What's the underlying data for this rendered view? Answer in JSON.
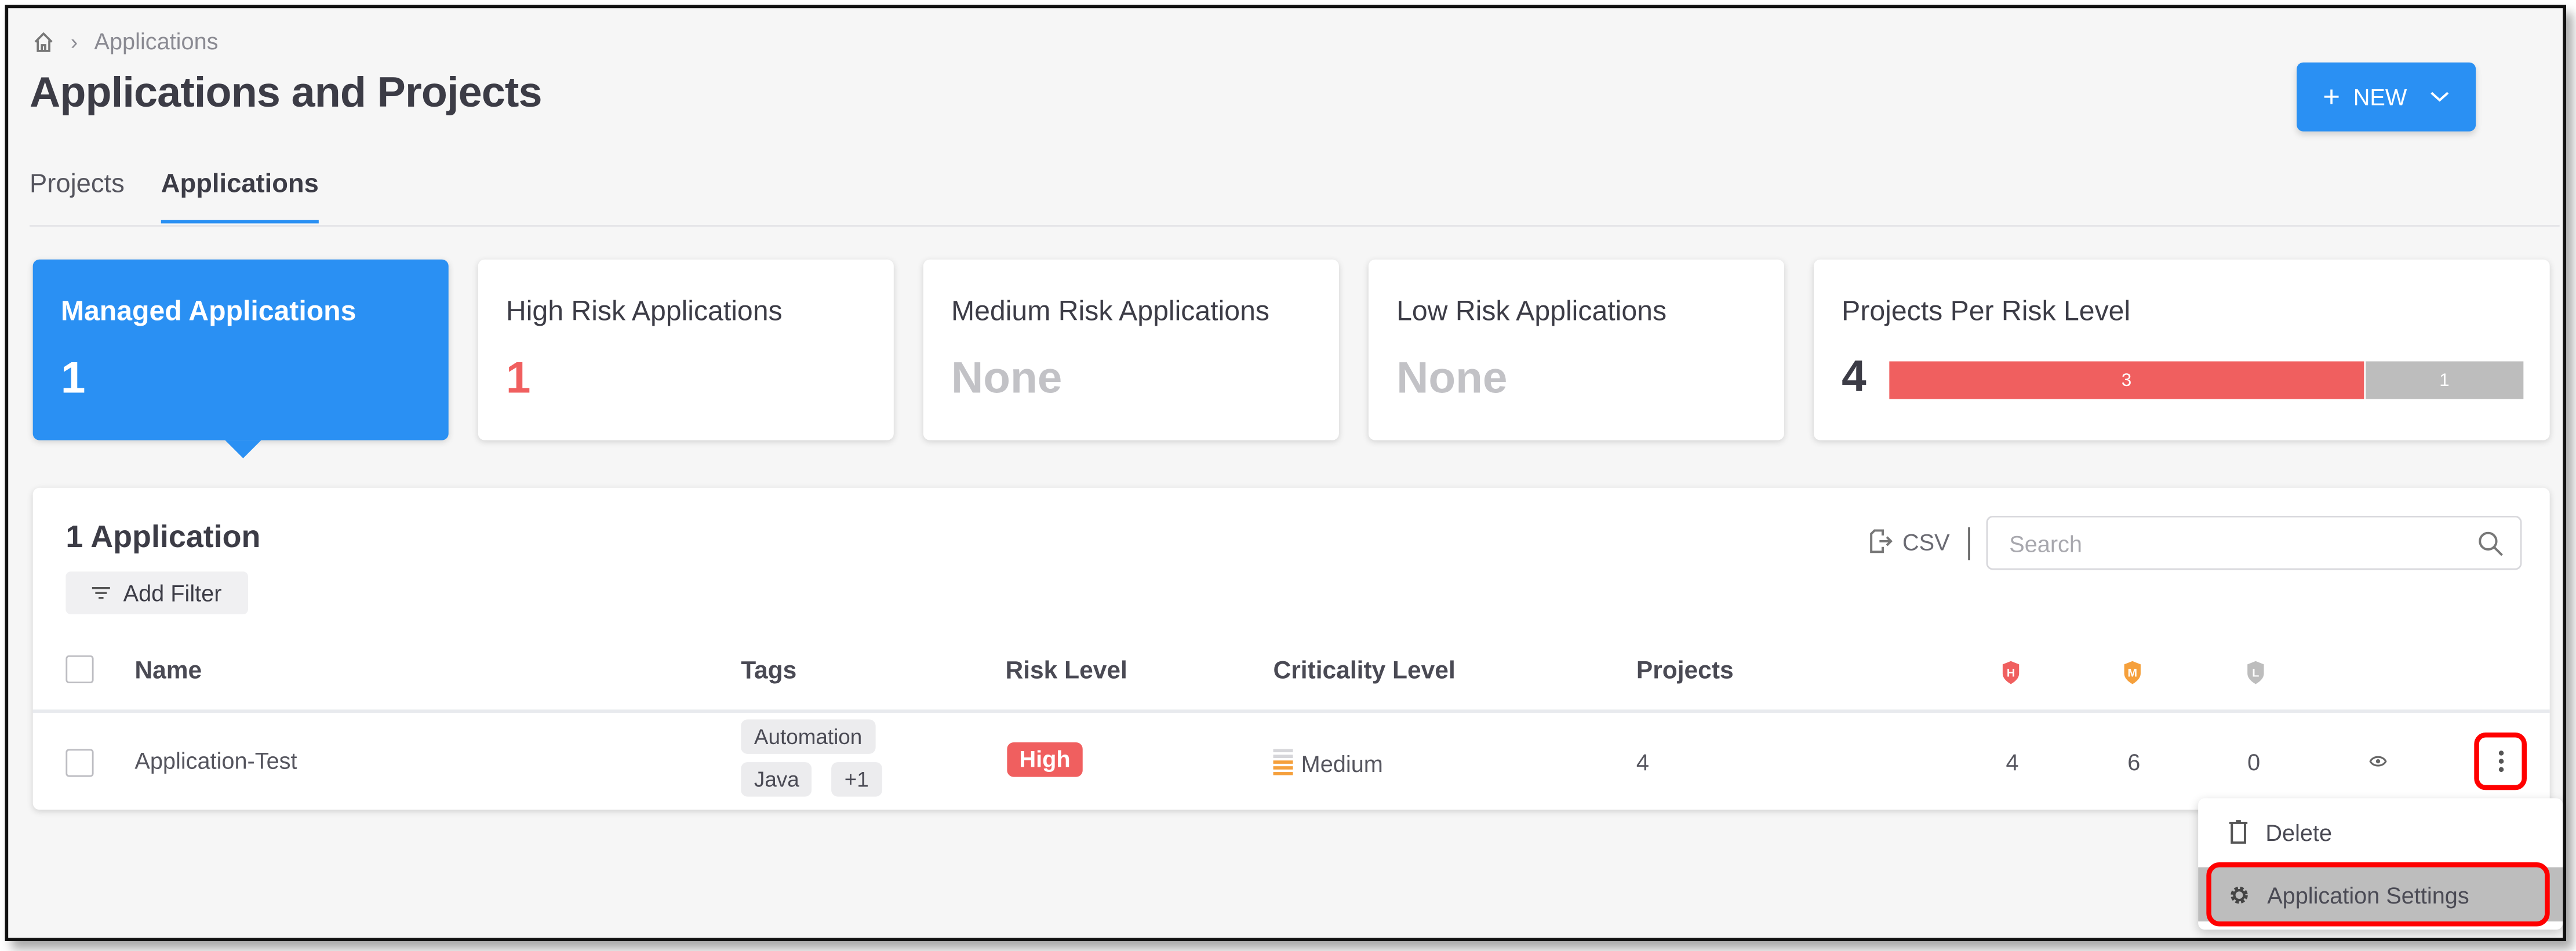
{
  "breadcrumb": {
    "home_icon": "home-icon",
    "items": [
      "Applications"
    ]
  },
  "page_title": "Applications and Projects",
  "new_button": {
    "label": "NEW",
    "color": "#2a90f3"
  },
  "tabs": [
    {
      "label": "Projects",
      "active": false
    },
    {
      "label": "Applications",
      "active": true
    }
  ],
  "cards": [
    {
      "title": "Managed Applications",
      "value": "1",
      "selected": true
    },
    {
      "title": "High Risk Applications",
      "value": "1",
      "value_color": "#f05f5f"
    },
    {
      "title": "Medium Risk Applications",
      "value": "None",
      "value_color": "#c2c2c6"
    },
    {
      "title": "Low Risk Applications",
      "value": "None",
      "value_color": "#c2c2c6"
    },
    {
      "title": "Projects Per Risk Level",
      "value": "4",
      "segments": [
        {
          "label": "3",
          "value": 3,
          "color": "#f05f5f"
        },
        {
          "label": "1",
          "value": 1,
          "color": "#bdbdbd"
        }
      ]
    }
  ],
  "table": {
    "count_label": "1 Application",
    "add_filter_label": "Add Filter",
    "csv_label": "CSV",
    "search_placeholder": "Search",
    "columns": [
      "Name",
      "Tags",
      "Risk Level",
      "Criticality Level",
      "Projects",
      "H",
      "M",
      "L"
    ],
    "rows": [
      {
        "name": "Application-Test",
        "tags": [
          "Automation",
          "Java",
          "+1"
        ],
        "risk_level": "High",
        "criticality": "Medium",
        "projects": "4",
        "high": "4",
        "medium": "6",
        "low": "0"
      }
    ]
  },
  "row_menu": {
    "items": [
      {
        "label": "Delete",
        "icon": "trash-icon"
      },
      {
        "label": "Application Settings",
        "icon": "gear-icon",
        "highlighted": true
      }
    ]
  }
}
